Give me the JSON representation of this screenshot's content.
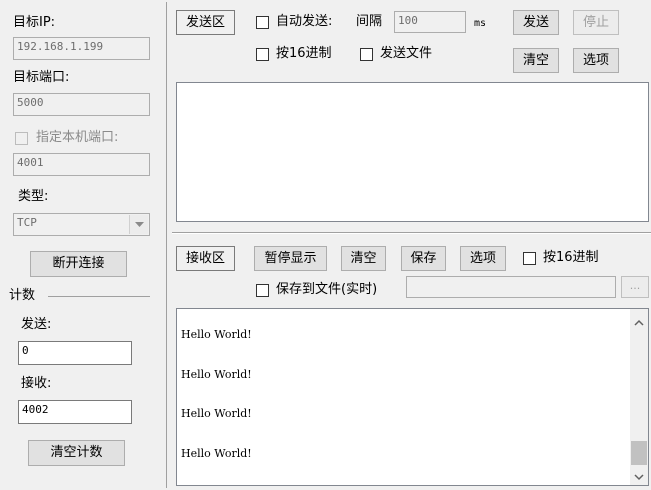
{
  "left_panel": {
    "target_ip_label": "目标IP:",
    "target_ip_value": "192.168.1.199",
    "target_port_label": "目标端口:",
    "target_port_value": "5000",
    "local_port_label": "指定本机端口:",
    "local_port_value": "4001",
    "type_label": "类型:",
    "type_value": "TCP",
    "disconnect_button": "断开连接",
    "counter_label": "计数",
    "sent_label": "发送:",
    "sent_value": "0",
    "recv_label": "接收:",
    "recv_value": "4002",
    "clear_count_button": "清空计数"
  },
  "send_area": {
    "tab_label": "发送区",
    "auto_send_label": "自动发送:",
    "interval_label": "间隔",
    "interval_value": "100",
    "interval_unit": "ms",
    "send_button": "发送",
    "stop_button": "停止",
    "hex_label": "按16进制",
    "send_file_label": "发送文件",
    "clear_button": "清空",
    "options_button": "选项"
  },
  "recv_area": {
    "tab_label": "接收区",
    "pause_button": "暂停显示",
    "clear_button": "清空",
    "save_button": "保存",
    "options_button": "选项",
    "hex_label": "按16进制",
    "save_to_file_label": "保存到文件(实时)",
    "browse_button": "...",
    "lines": [
      "Hello World!",
      "Hello World!",
      "Hello World!",
      "Hello World!"
    ]
  },
  "icons": {
    "dropdown": "chevron-down-icon",
    "scroll_up": "chevron-up-icon",
    "scroll_down": "chevron-down-icon"
  }
}
